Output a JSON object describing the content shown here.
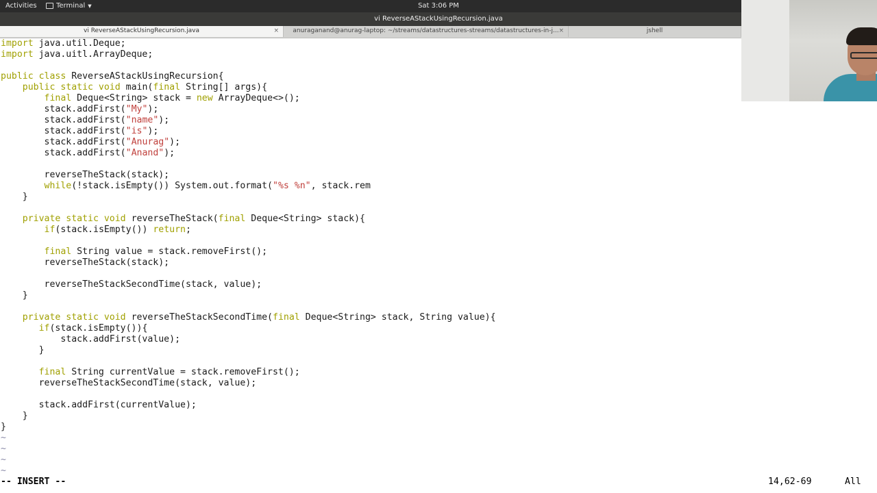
{
  "topbar": {
    "activities": "Activities",
    "app_menu": "Terminal",
    "clock": "Sat  3:06 PM"
  },
  "window": {
    "title": "vi ReverseAStackUsingRecursion.java"
  },
  "tabs": [
    {
      "label": "vi ReverseAStackUsingRecursion.java",
      "active": true
    },
    {
      "label": "anuraganand@anurag-laptop: ~/streams/datastructures-streams/datastructures-in-j...",
      "active": false
    },
    {
      "label": "jshell",
      "active": false
    }
  ],
  "editor": {
    "lines": [
      [
        [
          "kw",
          "import"
        ],
        [
          "t",
          " java.util.Deque;"
        ]
      ],
      [
        [
          "kw",
          "import"
        ],
        [
          "t",
          " java.uitl.ArrayDeque;"
        ]
      ],
      [],
      [
        [
          "kw",
          "public class"
        ],
        [
          "t",
          " ReverseAStackUsingRecursion{"
        ]
      ],
      [
        [
          "t",
          "    "
        ],
        [
          "kw",
          "public static void"
        ],
        [
          "t",
          " main("
        ],
        [
          "kw",
          "final"
        ],
        [
          "t",
          " String[] args){"
        ]
      ],
      [
        [
          "t",
          "        "
        ],
        [
          "kw",
          "final"
        ],
        [
          "t",
          " Deque<String> stack = "
        ],
        [
          "kw",
          "new"
        ],
        [
          "t",
          " ArrayDeque<>();"
        ]
      ],
      [
        [
          "t",
          "        stack.addFirst("
        ],
        [
          "st",
          "\"My\""
        ],
        [
          "t",
          ");"
        ]
      ],
      [
        [
          "t",
          "        stack.addFirst("
        ],
        [
          "st",
          "\"name\""
        ],
        [
          "t",
          ");"
        ]
      ],
      [
        [
          "t",
          "        stack.addFirst("
        ],
        [
          "st",
          "\"is\""
        ],
        [
          "t",
          ");"
        ]
      ],
      [
        [
          "t",
          "        stack.addFirst("
        ],
        [
          "st",
          "\"Anurag\""
        ],
        [
          "t",
          ");"
        ]
      ],
      [
        [
          "t",
          "        stack.addFirst("
        ],
        [
          "st",
          "\"Anand\""
        ],
        [
          "t",
          ");"
        ]
      ],
      [],
      [
        [
          "t",
          "        reverseTheStack(stack);"
        ]
      ],
      [
        [
          "t",
          "        "
        ],
        [
          "kw",
          "while"
        ],
        [
          "t",
          "(!stack.isEmpty()) System.out.format("
        ],
        [
          "st",
          "\"%s %n\""
        ],
        [
          "t",
          ", stack.rem"
        ]
      ],
      [
        [
          "t",
          "    }"
        ]
      ],
      [],
      [
        [
          "t",
          "    "
        ],
        [
          "kw",
          "private static void"
        ],
        [
          "t",
          " reverseTheStack("
        ],
        [
          "kw",
          "final"
        ],
        [
          "t",
          " Deque<String> stack){"
        ]
      ],
      [
        [
          "t",
          "        "
        ],
        [
          "kw",
          "if"
        ],
        [
          "t",
          "(stack.isEmpty()) "
        ],
        [
          "kw",
          "return"
        ],
        [
          "t",
          ";"
        ]
      ],
      [],
      [
        [
          "t",
          "        "
        ],
        [
          "kw",
          "final"
        ],
        [
          "t",
          " String value = stack.removeFirst();"
        ]
      ],
      [
        [
          "t",
          "        reverseTheStack(stack);"
        ]
      ],
      [],
      [
        [
          "t",
          "        reverseTheStackSecondTime(stack, value);"
        ]
      ],
      [
        [
          "t",
          "    }"
        ]
      ],
      [],
      [
        [
          "t",
          "    "
        ],
        [
          "kw",
          "private static void"
        ],
        [
          "t",
          " reverseTheStackSecondTime("
        ],
        [
          "kw",
          "final"
        ],
        [
          "t",
          " Deque<String> stack, String value){"
        ]
      ],
      [
        [
          "t",
          "       "
        ],
        [
          "kw",
          "if"
        ],
        [
          "t",
          "(stack.isEmpty()){"
        ]
      ],
      [
        [
          "t",
          "           stack.addFirst(value);"
        ]
      ],
      [
        [
          "t",
          "       }"
        ]
      ],
      [],
      [
        [
          "t",
          "       "
        ],
        [
          "kw",
          "final"
        ],
        [
          "t",
          " String currentValue = stack.removeFirst();"
        ]
      ],
      [
        [
          "t",
          "       reverseTheStackSecondTime(stack, value);"
        ]
      ],
      [],
      [
        [
          "t",
          "       stack.addFirst(currentValue);"
        ]
      ],
      [
        [
          "t",
          "    }"
        ]
      ],
      [
        [
          "t",
          "}"
        ]
      ],
      [
        [
          "tl",
          "~"
        ]
      ],
      [
        [
          "tl",
          "~"
        ]
      ],
      [
        [
          "tl",
          "~"
        ]
      ],
      [
        [
          "tl",
          "~"
        ]
      ]
    ]
  },
  "statusline": {
    "mode": "-- INSERT --",
    "position": "14,62-69",
    "scroll": "All"
  }
}
